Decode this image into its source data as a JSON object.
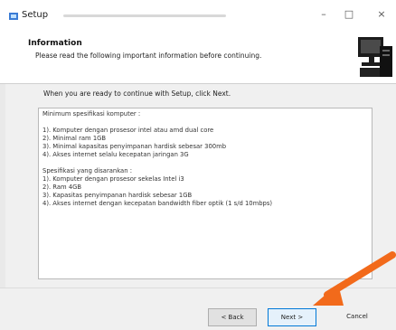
{
  "window": {
    "title": "Setup",
    "controls": {
      "minimize": "–",
      "maximize": "□",
      "close": "×"
    }
  },
  "header": {
    "title": "Information",
    "subtitle": "Please read the following important information before continuing.",
    "icon": "setup-computer-icon"
  },
  "content": {
    "intro": "When you are ready to continue with Setup, click Next.",
    "memo_lines": [
      "Minimum spesifikasi komputer :",
      "",
      "1). Komputer dengan prosesor intel atau amd dual core",
      "2). Minimal ram 1GB",
      "3). Minimal kapasitas penyimpanan hardisk sebesar 300mb",
      "4). Akses internet selalu kecepatan jaringan 3G",
      "",
      "Spesifikasi yang disarankan :",
      "1). Komputer dengan prosesor sekelas Intel i3",
      "2). Ram 4GB",
      "3). Kapasitas penyimpanan hardisk sebesar 1GB",
      "4). Akses internet dengan kecepatan bandwidth fiber optik (1 s/d 10mbps)"
    ]
  },
  "footer": {
    "back_label": "< Back",
    "next_label": "Next >",
    "cancel_label": "Cancel"
  },
  "colors": {
    "arrow": "#f26a1b",
    "focus_border": "#0078d7",
    "dialog_bg": "#f0f0f0"
  }
}
